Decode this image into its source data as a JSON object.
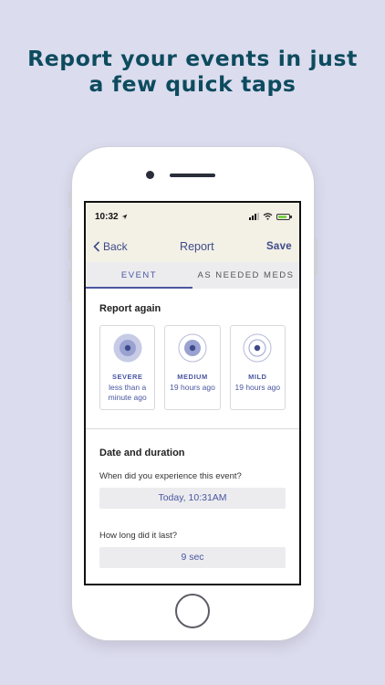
{
  "headline": {
    "line1": "Report your events in just",
    "line2": "a few quick taps"
  },
  "status_bar": {
    "time": "10:32"
  },
  "nav": {
    "back_label": "Back",
    "title": "Report",
    "save_label": "Save"
  },
  "tabs": [
    {
      "label": "EVENT",
      "active": true
    },
    {
      "label": "AS NEEDED MEDS",
      "active": false
    }
  ],
  "report_again": {
    "title": "Report again",
    "cards": [
      {
        "label": "SEVERE",
        "time": "less than a minute ago"
      },
      {
        "label": "MEDIUM",
        "time": "19 hours ago"
      },
      {
        "label": "MILD",
        "time": "19 hours ago"
      }
    ]
  },
  "date_duration": {
    "title": "Date and duration",
    "when_question": "When did you experience this event?",
    "when_value": "Today, 10:31AM",
    "duration_question": "How long did it last?",
    "duration_value": "9 sec"
  },
  "colors": {
    "background": "#dcdcef",
    "headline": "#0d4b5e",
    "accent": "#4a56a0",
    "navbar": "#f3f0e6"
  }
}
